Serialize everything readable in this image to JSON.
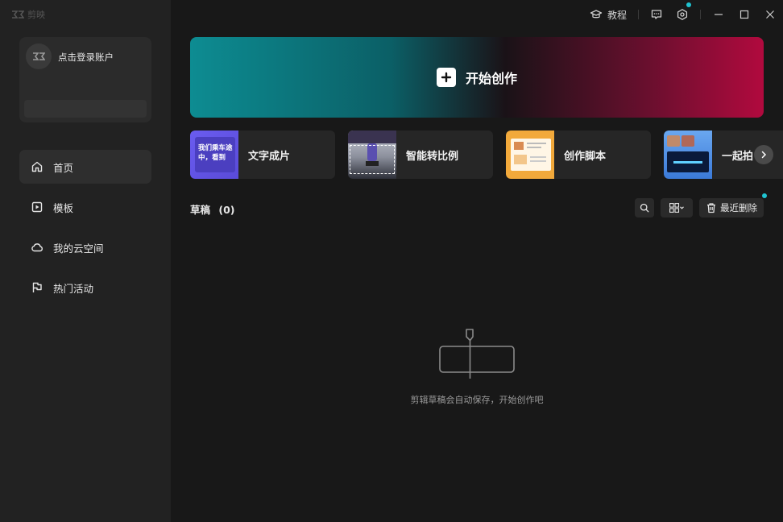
{
  "app": {
    "logo_text": "剪映"
  },
  "account": {
    "login_text": "点击登录账户"
  },
  "nav": [
    {
      "label": "首页",
      "icon": "home-icon",
      "active": true
    },
    {
      "label": "模板",
      "icon": "template-icon",
      "active": false
    },
    {
      "label": "我的云空间",
      "icon": "cloud-icon",
      "active": false
    },
    {
      "label": "热门活动",
      "icon": "flag-icon",
      "active": false
    }
  ],
  "titlebar": {
    "tutorial_label": "教程"
  },
  "hero": {
    "label": "开始创作"
  },
  "tools": [
    {
      "label": "文字成片",
      "thumb_text": "我们乘车途中，看到"
    },
    {
      "label": "智能转比例"
    },
    {
      "label": "创作脚本"
    },
    {
      "label": "一起拍"
    }
  ],
  "drafts": {
    "title": "草稿",
    "count": "(0)",
    "recent_delete_label": "最近删除",
    "empty_text": "剪辑草稿会自动保存，开始创作吧"
  },
  "colors": {
    "accent_dot": "#1fc3d0",
    "sidebar_bg": "#222222",
    "main_bg": "#181818"
  }
}
